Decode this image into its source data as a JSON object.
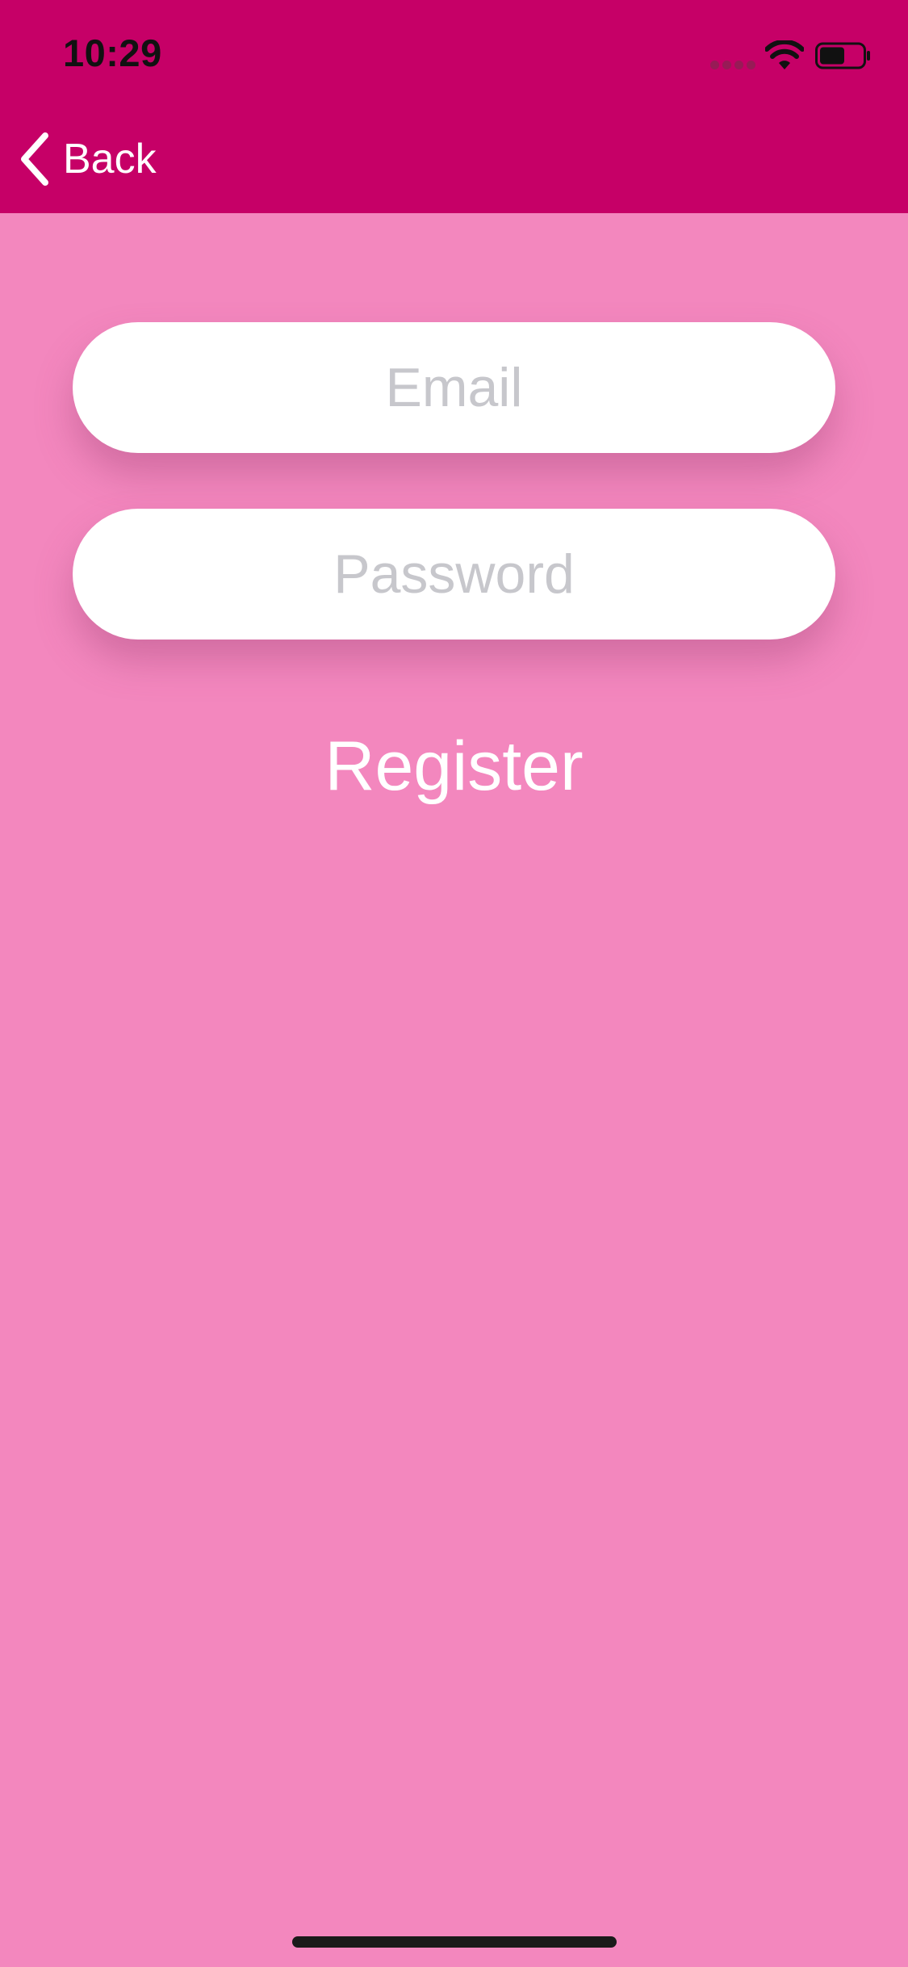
{
  "status_bar": {
    "time": "10:29"
  },
  "nav": {
    "back_label": "Back",
    "back_icon": "chevron-left-icon"
  },
  "form": {
    "email": {
      "placeholder": "Email",
      "value": ""
    },
    "password": {
      "placeholder": "Password",
      "value": ""
    },
    "register_label": "Register"
  },
  "colors": {
    "header": "#C60067",
    "background": "#F387BE",
    "field": "#FFFFFF",
    "placeholder": "#C7C7CC"
  }
}
